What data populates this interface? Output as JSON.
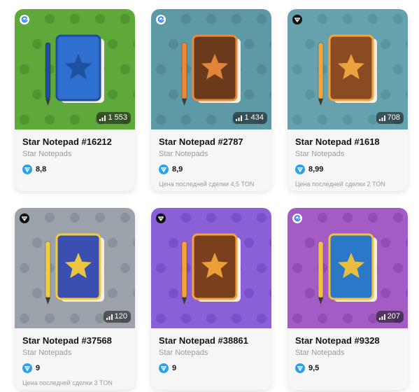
{
  "cards": [
    {
      "name": "Star Notepad #16212",
      "collection": "Star Notepads",
      "price": "8,8",
      "count": "1 553",
      "last_sale": "",
      "market_icon": "getgems-icon",
      "colors": {
        "bg": "#5fa83a",
        "pattern": "#4a8f2c",
        "cover": "#2f6fd0",
        "accent": "#1d4f9f"
      }
    },
    {
      "name": "Star Notepad #2787",
      "collection": "Star Notepads",
      "price": "8,9",
      "count": "1 434",
      "last_sale": "Цена последней сделки 4,5 TON",
      "market_icon": "getgems-icon",
      "colors": {
        "bg": "#5e9aa6",
        "pattern": "#4b8591",
        "cover": "#6b3a1c",
        "accent": "#e9893a"
      }
    },
    {
      "name": "Star Notepad #1618",
      "collection": "Star Notepads",
      "price": "8,99",
      "count": "708",
      "last_sale": "Цена последней сделки 2 TON",
      "market_icon": "tonnel-icon",
      "colors": {
        "bg": "#66a2ad",
        "pattern": "#52909a",
        "cover": "#8a4a22",
        "accent": "#f0a640"
      }
    },
    {
      "name": "Star Notepad #37568",
      "collection": "Star Notepads",
      "price": "9",
      "count": "120",
      "last_sale": "Цена последней сделки 3 TON",
      "market_icon": "tonnel-icon",
      "colors": {
        "bg": "#9ba2aa",
        "pattern": "#858c95",
        "cover": "#3a4fb0",
        "accent": "#f3cc3c"
      }
    },
    {
      "name": "Star Notepad #38861",
      "collection": "Star Notepads",
      "price": "9",
      "count": "",
      "last_sale": "",
      "market_icon": "tonnel-icon",
      "colors": {
        "bg": "#8b5fd6",
        "pattern": "#7549c2",
        "cover": "#7a3f1c",
        "accent": "#f2a33a"
      }
    },
    {
      "name": "Star Notepad #9328",
      "collection": "Star Notepads",
      "price": "9,5",
      "count": "207",
      "last_sale": "",
      "market_icon": "getgems-icon",
      "colors": {
        "bg": "#a35cc4",
        "pattern": "#8c46ad",
        "cover": "#2b78c8",
        "accent": "#f2c23a"
      }
    }
  ]
}
